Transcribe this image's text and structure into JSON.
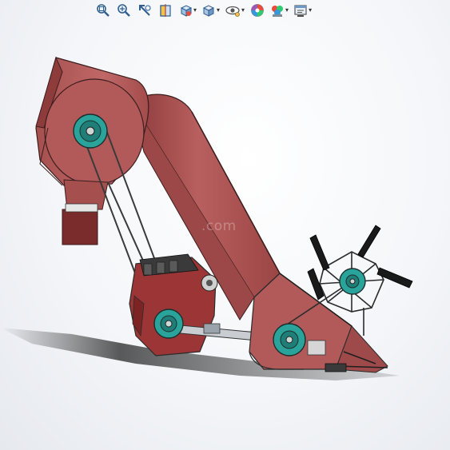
{
  "toolbar": {
    "buttons": [
      {
        "name": "zoom-to-fit-icon",
        "has_menu": false
      },
      {
        "name": "zoom-to-area-icon",
        "has_menu": false
      },
      {
        "name": "previous-view-icon",
        "has_menu": false
      },
      {
        "name": "section-view-icon",
        "has_menu": false
      },
      {
        "name": "view-orientation-icon",
        "has_menu": true
      },
      {
        "name": "display-style-icon",
        "has_menu": true
      },
      {
        "name": "hide-show-items-icon",
        "has_menu": true
      },
      {
        "name": "edit-appearance-icon",
        "has_menu": false
      },
      {
        "name": "apply-scene-icon",
        "has_menu": true
      },
      {
        "name": "view-settings-icon",
        "has_menu": true
      }
    ]
  },
  "model": {
    "body_color": "#b25a5a",
    "pulley_color": "#2aa39a",
    "frame_color": "#2b2b2b"
  },
  "watermark": {
    "text": "        .com"
  }
}
